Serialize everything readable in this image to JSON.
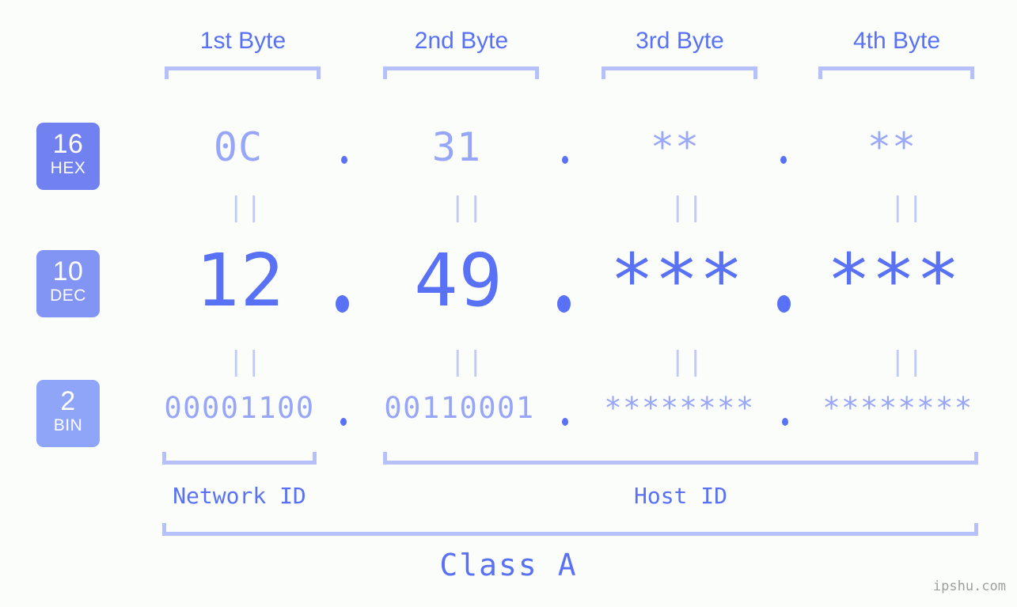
{
  "meta": {
    "background_color": "#fbfdfa",
    "accent_color": "#5871f5",
    "muted_color": "#97a6f9",
    "light_color": "#b6c0fb",
    "watermark_color": "#9e9e9e"
  },
  "header": {
    "bytes": [
      {
        "label": "1st Byte"
      },
      {
        "label": "2nd Byte"
      },
      {
        "label": "3rd Byte"
      },
      {
        "label": "4th Byte"
      }
    ]
  },
  "bases": [
    {
      "number": "16",
      "name": "HEX",
      "color": "#7181ef"
    },
    {
      "number": "10",
      "name": "DEC",
      "color": "#8294f4"
    },
    {
      "number": "2",
      "name": "BIN",
      "color": "#8fa6f8"
    }
  ],
  "rows": {
    "hex": {
      "base": "16",
      "name": "HEX",
      "values": [
        "0C",
        "31",
        "**",
        "**"
      ]
    },
    "dec": {
      "base": "10",
      "name": "DEC",
      "values": [
        "12",
        "49",
        "***",
        "***"
      ]
    },
    "bin": {
      "base": "2",
      "name": "BIN",
      "values": [
        "00001100",
        "00110001",
        "********",
        "********"
      ]
    }
  },
  "separator": {
    "dot": ".",
    "equals": "||"
  },
  "footer": {
    "network_id_label": "Network ID",
    "host_id_label": "Host ID",
    "class_label": "Class A",
    "watermark": "ipshu.com"
  }
}
